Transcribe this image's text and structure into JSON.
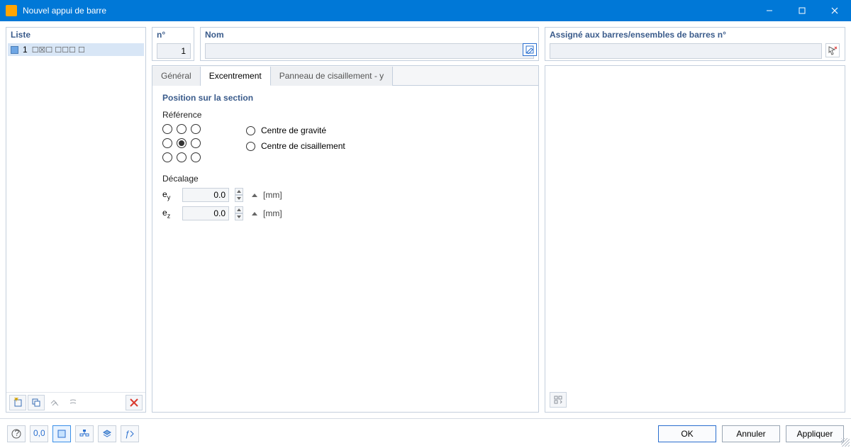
{
  "window": {
    "title": "Nouvel appui de barre"
  },
  "left": {
    "header": "Liste",
    "items": [
      {
        "num": "1",
        "glyphs": "☐☒☐  ☐☐☐  ☐"
      }
    ]
  },
  "top": {
    "num_label": "n°",
    "num_value": "1",
    "nom_label": "Nom",
    "nom_value": "",
    "assign_label": "Assigné aux barres/ensembles de barres n°",
    "assign_value": ""
  },
  "tabs": {
    "general": "Général",
    "excentrement": "Excentrement",
    "panneau": "Panneau de cisaillement - y"
  },
  "section": {
    "title": "Position sur la section",
    "reference": "Référence",
    "centre_gravite": "Centre de gravité",
    "centre_cisaillement": "Centre de cisaillement",
    "decalage": "Décalage",
    "ey_label": "e",
    "ey_sub": "y",
    "ez_label": "e",
    "ez_sub": "z",
    "ey_value": "0.0",
    "ez_value": "0.0",
    "unit": "[mm]"
  },
  "footer": {
    "ok": "OK",
    "cancel": "Annuler",
    "apply": "Appliquer"
  }
}
